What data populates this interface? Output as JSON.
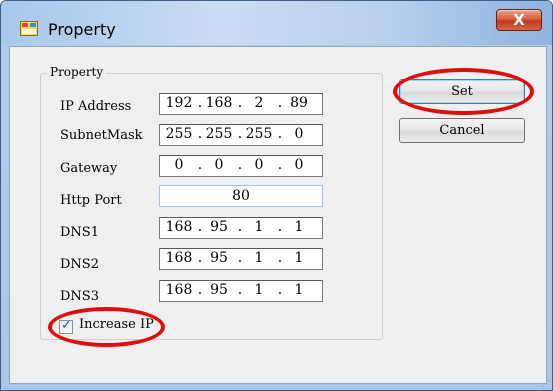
{
  "window": {
    "title": "Property",
    "close_glyph": "X"
  },
  "group": {
    "legend": "Property"
  },
  "fields": {
    "ip_address": {
      "label": "IP Address",
      "octets": [
        "192",
        "168",
        "2",
        "89"
      ]
    },
    "subnet_mask": {
      "label": "SubnetMask",
      "octets": [
        "255",
        "255",
        "255",
        "0"
      ]
    },
    "gateway": {
      "label": "Gateway",
      "octets": [
        "0",
        "0",
        "0",
        "0"
      ]
    },
    "http_port": {
      "label": "Http Port",
      "value": "80"
    },
    "dns1": {
      "label": "DNS1",
      "octets": [
        "168",
        "95",
        "1",
        "1"
      ]
    },
    "dns2": {
      "label": "DNS2",
      "octets": [
        "168",
        "95",
        "1",
        "1"
      ]
    },
    "dns3": {
      "label": "DNS3",
      "octets": [
        "168",
        "95",
        "1",
        "1"
      ]
    }
  },
  "checkbox": {
    "label": "Increase IP",
    "checked": true
  },
  "buttons": {
    "set": "Set",
    "cancel": "Cancel"
  },
  "annotation_color": "#e00d0d",
  "icons": [
    "window-app-icon",
    "close-icon",
    "checkmark-icon",
    "resize-grip-icon"
  ]
}
